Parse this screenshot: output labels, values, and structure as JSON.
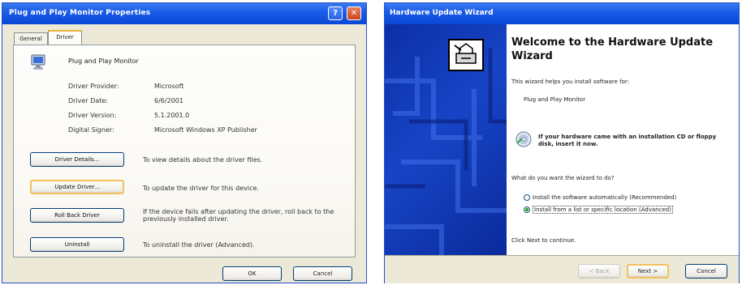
{
  "left_dialog": {
    "title": "Plug and Play Monitor Properties",
    "help_glyph": "?",
    "close_glyph": "✕",
    "tabs": [
      "General",
      "Driver"
    ],
    "active_tab": "Driver",
    "device_name": "Plug and Play Monitor",
    "fields": [
      {
        "label": "Driver Provider:",
        "value": "Microsoft"
      },
      {
        "label": "Driver Date:",
        "value": "6/6/2001"
      },
      {
        "label": "Driver Version:",
        "value": "5.1.2001.0"
      },
      {
        "label": "Digital Signer:",
        "value": "Microsoft Windows XP Publisher"
      }
    ],
    "actions": [
      {
        "button": "Driver Details...",
        "description": "To view details about the driver files."
      },
      {
        "button": "Update Driver...",
        "description": "To update the driver for this device."
      },
      {
        "button": "Roll Back Driver",
        "description": "If the device fails after updating the driver, roll back to the previously installed driver."
      },
      {
        "button": "Uninstall",
        "description": "To uninstall the driver (Advanced)."
      }
    ],
    "ok_label": "OK",
    "cancel_label": "Cancel"
  },
  "wizard": {
    "title": "Hardware Update Wizard",
    "heading": "Welcome to the Hardware Update Wizard",
    "intro": "This wizard helps you install software for:",
    "device": "Plug and Play Monitor",
    "cd_note": "If your hardware came with an installation CD or floppy disk, insert it now.",
    "question": "What do you want the wizard to do?",
    "options": [
      {
        "label": "Install the software automatically (Recommended)",
        "selected": false
      },
      {
        "label": "Install from a list or specific location (Advanced)",
        "selected": true
      }
    ],
    "continue_text": "Click Next to continue.",
    "back_label": "< Back",
    "next_label": "Next >",
    "cancel_label": "Cancel"
  },
  "colors": {
    "titlebar": "#0a48d6",
    "dialog_bg": "#ece9d8",
    "wizard_side": "#1744c6",
    "focus_border": "#f4c15e"
  }
}
